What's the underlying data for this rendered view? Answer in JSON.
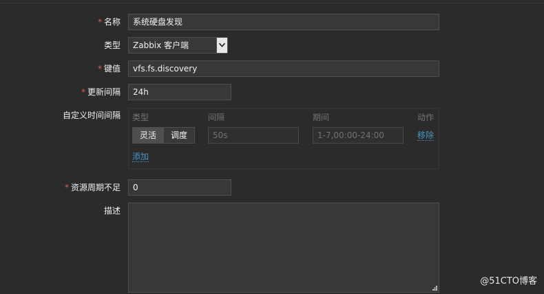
{
  "form": {
    "name": {
      "required": "*",
      "label": "名称",
      "value": "系统硬盘发现"
    },
    "type": {
      "label": "类型",
      "value": "Zabbix 客户端"
    },
    "key": {
      "required": "*",
      "label": "键值",
      "value": "vfs.fs.discovery"
    },
    "update_interval": {
      "required": "*",
      "label": "更新间隔",
      "value": "24h"
    },
    "custom_intervals": {
      "label": "自定义时间间隔",
      "headers": {
        "type": "类型",
        "interval": "间隔",
        "period": "期间",
        "action": "动作"
      },
      "row": {
        "mode_flexible": "灵活",
        "mode_scheduling": "调度",
        "interval_placeholder": "50s",
        "period_placeholder": "1-7,00:00-24:00",
        "remove": "移除"
      },
      "add": "添加"
    },
    "lifetime": {
      "required": "*",
      "label": "资源周期不足",
      "value": "0"
    },
    "description": {
      "label": "描述",
      "value": ""
    }
  },
  "watermark": "@51CTO博客",
  "colors": {
    "background": "#2b2b2b",
    "input_bg": "#383838",
    "border": "#4f4f4f",
    "required": "#e45959",
    "link": "#4796c4",
    "muted": "#737373"
  }
}
